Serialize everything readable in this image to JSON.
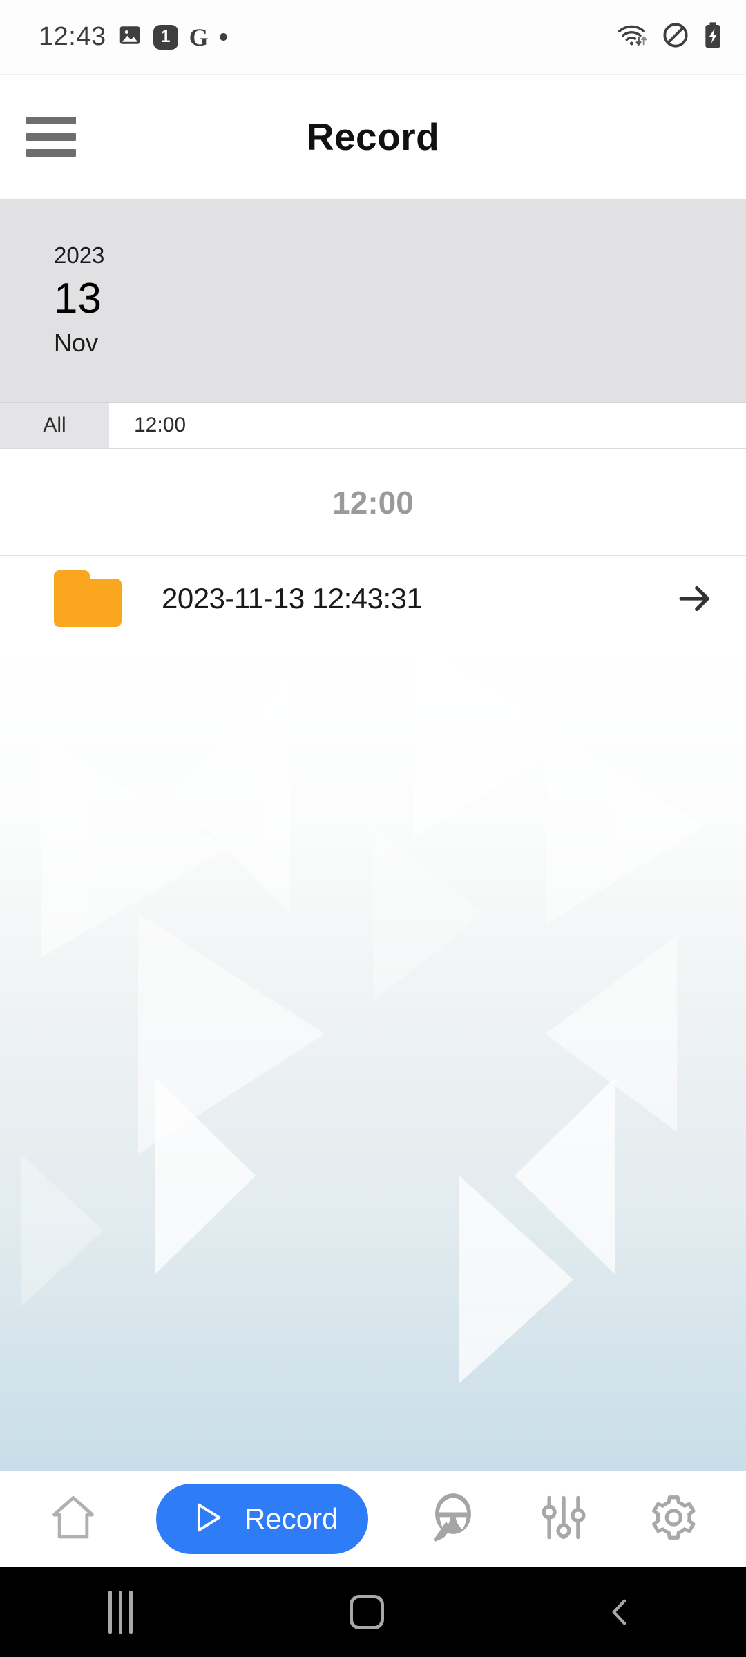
{
  "status_bar": {
    "clock": "12:43",
    "left_icons": [
      "image-icon",
      "notification-count-badge",
      "google-icon",
      "dot-icon"
    ],
    "notification_count": "1",
    "google_letter": "G",
    "right_icons": [
      "wifi-icon",
      "do-not-disturb-icon",
      "battery-charging-icon"
    ]
  },
  "app_bar": {
    "menu_icon": "hamburger-menu-icon",
    "title": "Record"
  },
  "date_card": {
    "year": "2023",
    "day": "13",
    "month": "Nov"
  },
  "tabs": [
    {
      "label": "All",
      "active": false
    },
    {
      "label": "12:00",
      "active": true
    }
  ],
  "section_header": {
    "label": "12:00"
  },
  "file_list": [
    {
      "icon": "folder-icon",
      "name": "2023-11-13 12:43:31",
      "chevron": "arrow-right-icon"
    }
  ],
  "bottom_nav": [
    {
      "name": "home",
      "icon": "home-icon",
      "label": "",
      "active": false
    },
    {
      "name": "record",
      "icon": "play-icon",
      "label": "Record",
      "active": true
    },
    {
      "name": "driving",
      "icon": "steering-wheel-icon",
      "label": "",
      "active": false
    },
    {
      "name": "tuning",
      "icon": "sliders-icon",
      "label": "",
      "active": false
    },
    {
      "name": "settings",
      "icon": "gear-icon",
      "label": "",
      "active": false
    }
  ],
  "android_nav": [
    {
      "name": "recents",
      "icon": "recents-icon"
    },
    {
      "name": "home",
      "icon": "home-square-icon"
    },
    {
      "name": "back",
      "icon": "chevron-left-icon"
    }
  ],
  "colors": {
    "accent_blue": "#2f7df6",
    "folder_orange": "#faa61e",
    "date_card_gray": "#e1e1e3",
    "section_text_gray": "#9a9a9a",
    "nav_icon_gray": "#a8a8a8",
    "android_nav_black": "#000000"
  }
}
